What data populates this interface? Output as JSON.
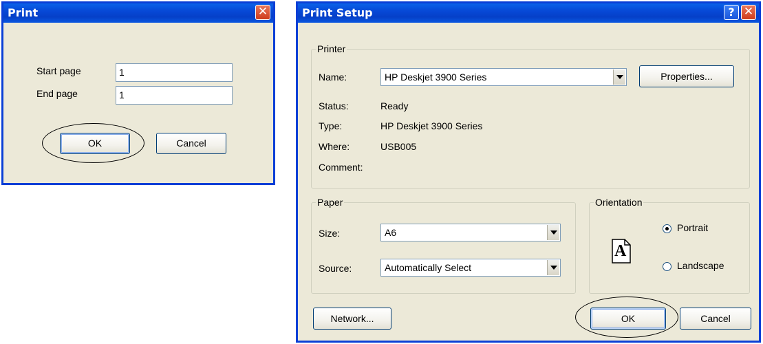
{
  "print_dialog": {
    "title": "Print",
    "close_glyph": "✕",
    "start_page_label": "Start page",
    "start_page_value": "1",
    "end_page_label": "End page",
    "end_page_value": "1",
    "ok_label": "OK",
    "cancel_label": "Cancel"
  },
  "print_setup": {
    "title": "Print Setup",
    "help_glyph": "?",
    "close_glyph": "✕",
    "printer_group": {
      "title": "Printer",
      "name_label": "Name:",
      "name_value": "HP Deskjet 3900 Series",
      "properties_label": "Properties...",
      "status_label": "Status:",
      "status_value": "Ready",
      "type_label": "Type:",
      "type_value": "HP Deskjet 3900 Series",
      "where_label": "Where:",
      "where_value": "USB005",
      "comment_label": "Comment:"
    },
    "paper_group": {
      "title": "Paper",
      "size_label": "Size:",
      "size_value": "A6",
      "source_label": "Source:",
      "source_value": "Automatically Select"
    },
    "orientation_group": {
      "title": "Orientation",
      "page_glyph": "A",
      "portrait_label": "Portrait",
      "landscape_label": "Landscape",
      "selected": "Portrait"
    },
    "network_label": "Network...",
    "ok_label": "OK",
    "cancel_label": "Cancel"
  },
  "colors": {
    "title_bar": "#0a3fd6",
    "dialog_face": "#ece9d8",
    "close_button": "#cf3c1c"
  }
}
